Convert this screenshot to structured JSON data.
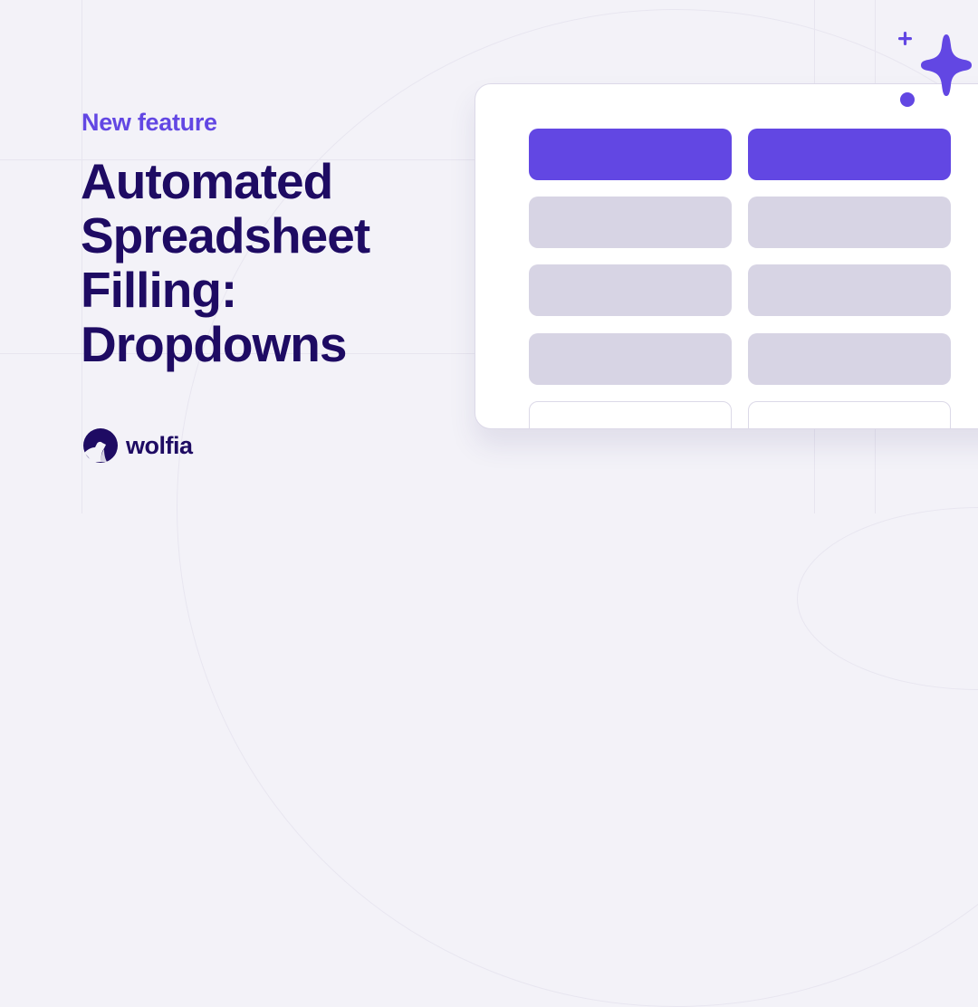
{
  "eyebrow": "New feature",
  "headline": {
    "lines": [
      "Automated",
      "Spreadsheet",
      "Filling:",
      "Dropdowns"
    ]
  },
  "brand": {
    "name": "wolfia",
    "logo_icon": "wolf-howling-icon"
  },
  "illustration": {
    "type": "spreadsheet-mockup",
    "columns": 2,
    "rows": [
      {
        "kind": "header"
      },
      {
        "kind": "filled"
      },
      {
        "kind": "filled"
      },
      {
        "kind": "filled"
      },
      {
        "kind": "empty"
      }
    ],
    "decoration_icon": "sparkle-icon"
  },
  "colors": {
    "accent": "#6247e3",
    "headline": "#1e0b63",
    "background": "#f3f2f8",
    "cell_filled": "#d7d4e4",
    "card": "#ffffff"
  }
}
